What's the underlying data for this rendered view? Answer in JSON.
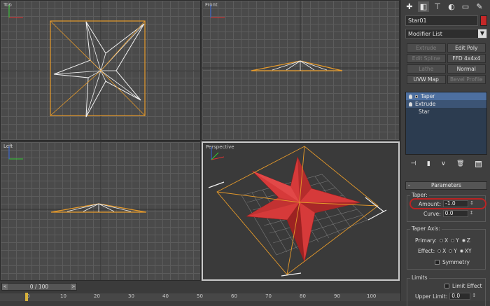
{
  "viewports": {
    "top": "Top",
    "front": "Front",
    "left": "Left",
    "perspective": "Perspective"
  },
  "command_panel": {
    "tab_icons": [
      "create-icon",
      "modify-icon",
      "hierarchy-icon",
      "motion-icon",
      "display-icon",
      "utilities-icon"
    ],
    "object_name": "Star01",
    "object_color": "#c52828",
    "modifier_list_label": "Modifier List",
    "modifier_buttons": [
      {
        "label": "Extrude",
        "enabled": false
      },
      {
        "label": "Edit Poly",
        "enabled": true
      },
      {
        "label": "Edit Spline",
        "enabled": false
      },
      {
        "label": "FFD 4x4x4",
        "enabled": true
      },
      {
        "label": "Lathe",
        "enabled": false
      },
      {
        "label": "Normal",
        "enabled": true
      },
      {
        "label": "UVW Map",
        "enabled": true
      },
      {
        "label": "Bevel Profile",
        "enabled": false
      }
    ],
    "stack": [
      {
        "label": "Taper",
        "state": "selected"
      },
      {
        "label": "Extrude",
        "state": "sub"
      },
      {
        "label": "Star",
        "state": "base"
      }
    ],
    "stack_tools": [
      "pin-stack-icon",
      "show-end-result-icon",
      "make-unique-icon",
      "remove-modifier-icon",
      "configure-sets-icon"
    ]
  },
  "parameters": {
    "rollout_title": "Parameters",
    "taper_group": "Taper:",
    "amount_label": "Amount:",
    "amount_value": "-1.0",
    "curve_label": "Curve:",
    "curve_value": "0.0",
    "axis_group": "Taper Axis:",
    "primary_label": "Primary:",
    "primary_options": [
      "X",
      "Y",
      "Z"
    ],
    "primary_selected": "Z",
    "effect_label": "Effect:",
    "effect_options": [
      "X",
      "Y",
      "XY"
    ],
    "effect_selected": "XY",
    "symmetry_label": "Symmetry",
    "limits_group": "Limits",
    "limit_effect_label": "Limit Effect",
    "upper_limit_label": "Upper Limit:",
    "upper_limit_value": "0.0"
  },
  "timeline": {
    "frame_display": "0 / 100",
    "ticks": [
      "0",
      "10",
      "20",
      "30",
      "40",
      "50",
      "60",
      "70",
      "80",
      "90",
      "100"
    ]
  }
}
